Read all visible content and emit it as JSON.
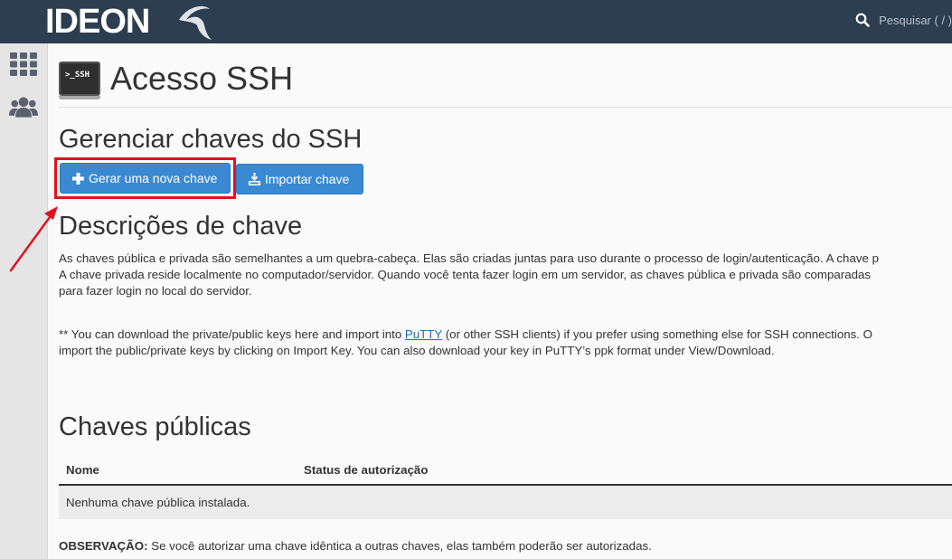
{
  "header": {
    "logo_text": "IDEON",
    "search_placeholder": "Pesquisar ( / )"
  },
  "sidebar": {
    "items": [
      {
        "icon": "grid-icon"
      },
      {
        "icon": "users-icon"
      }
    ]
  },
  "page": {
    "title": "Acesso SSH",
    "icon_label": ">_SSH"
  },
  "manage": {
    "heading": "Gerenciar chaves do SSH",
    "generate_label": "Gerar uma nova chave",
    "import_label": "Importar chave"
  },
  "descriptions": {
    "heading": "Descrições de chave",
    "line1": "As chaves pública e privada são semelhantes a um quebra-cabeça. Elas são criadas juntas para uso durante o processo de login/autenticação. A chave p",
    "line2": "A chave privada reside localmente no computador/servidor. Quando você tenta fazer login em um servidor, as chaves pública e privada são comparadas",
    "line3": "para fazer login no local do servidor.",
    "putty_pre": "** You can download the private/public keys here and import into ",
    "putty_link": "PuTTY",
    "putty_post": " (or other SSH clients) if you prefer using something else for SSH connections. O",
    "line5": "import the public/private keys by clicking on Import Key. You can also download your key in PuTTY’s ppk format under View/Download."
  },
  "public_keys": {
    "heading": "Chaves públicas",
    "columns": [
      "Nome",
      "Status de autorização"
    ],
    "empty_message": "Nenhuma chave pública instalada."
  },
  "note": {
    "label": "OBSERVAÇÃO:",
    "text": " Se você autorizar uma chave idêntica a outras chaves, elas também poderão ser autorizadas."
  },
  "colors": {
    "topbar": "#2c3e50",
    "button": "#3a8ad3",
    "highlight": "#e0141b",
    "link": "#1a6fb7"
  }
}
